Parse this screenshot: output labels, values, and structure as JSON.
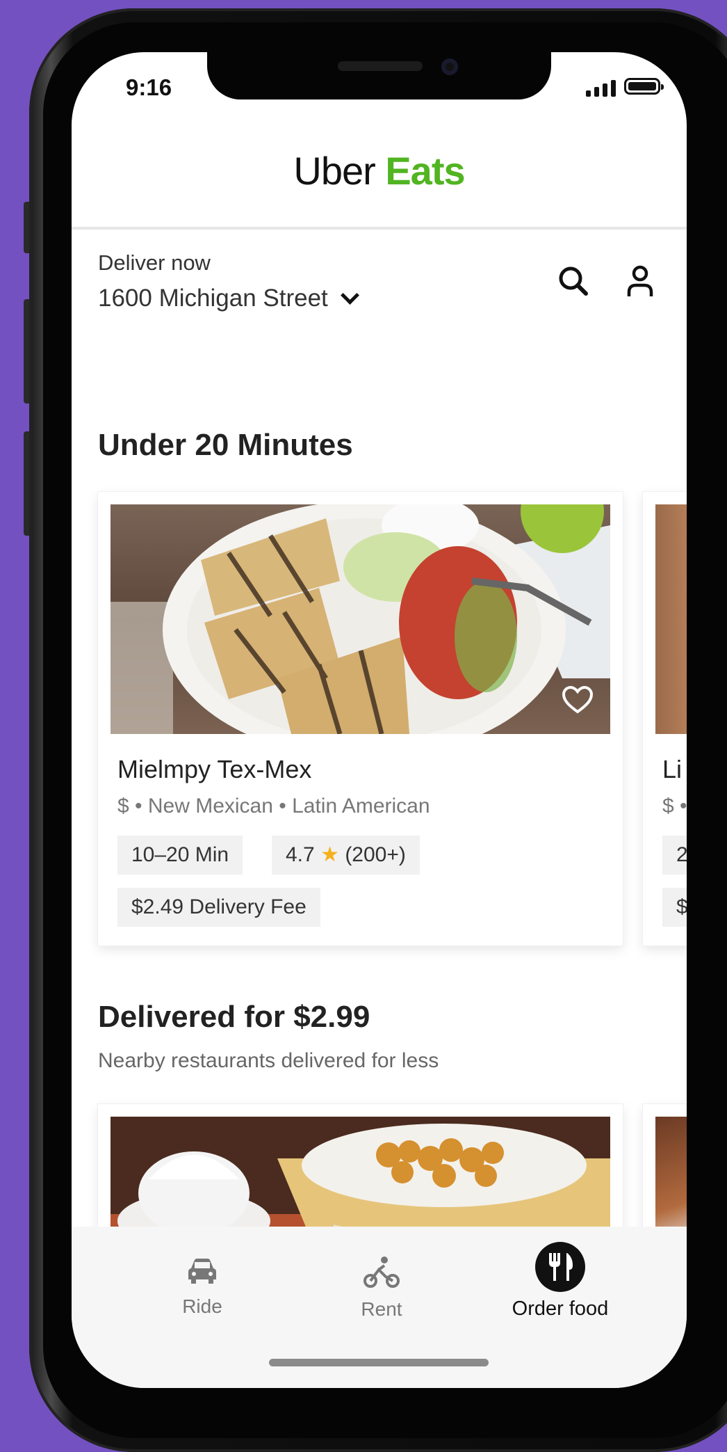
{
  "status_bar": {
    "time": "9:16"
  },
  "header": {
    "logo_uber": "Uber",
    "logo_eats": "Eats"
  },
  "delivery": {
    "label": "Deliver now",
    "address": "1600 Michigan Street"
  },
  "sections": [
    {
      "title": "Under 20 Minutes",
      "restaurants": [
        {
          "name": "Mielmpy Tex-Mex",
          "meta": "$ • New Mexican • Latin American",
          "time": "10–20 Min",
          "rating": "4.7",
          "reviews": "(200+)",
          "fee": "$2.49 Delivery Fee"
        },
        {
          "name_partial": "Li",
          "meta_partial": "$ •",
          "time_partial": "2",
          "fee_partial": "$"
        }
      ]
    },
    {
      "title": "Delivered for $2.99",
      "subtitle": "Nearby restaurants delivered for less"
    }
  ],
  "bottom_nav": [
    {
      "label": "Ride",
      "icon": "car-icon",
      "active": false
    },
    {
      "label": "Rent",
      "icon": "scooter-icon",
      "active": false
    },
    {
      "label": "Order food",
      "icon": "fork-knife-icon",
      "active": true
    }
  ],
  "colors": {
    "background": "#7451c1",
    "brand_green": "#51b421",
    "star": "#f5b01d"
  }
}
